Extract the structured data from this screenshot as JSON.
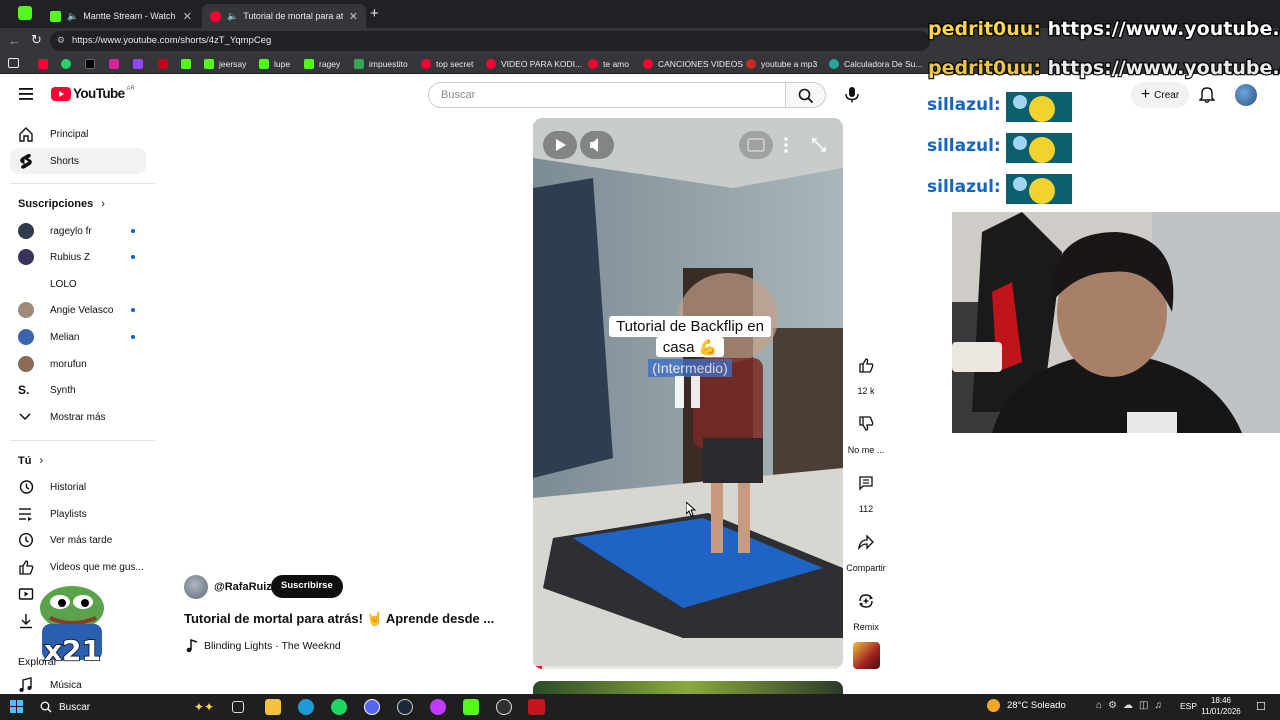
{
  "browser": {
    "tabs": [
      {
        "title": "Mantte Stream - Watch Live o",
        "close": "✕"
      },
      {
        "title": "Tutorial de mortal para atrás! ",
        "close": "✕"
      }
    ],
    "new_tab": "+",
    "url": "https://www.youtube.com/shorts/4zT_YqmpCeg",
    "bookmarks": [
      "jeersay",
      "lupe",
      "ragey",
      "impuestito",
      "top secret",
      "VIDEO PARA KODI...",
      "te amo",
      "CANCIONES VIDEOS",
      "youtube a mp3",
      "Calculadora De Su..."
    ]
  },
  "youtube": {
    "logo_text": "YouTube",
    "country": "AR",
    "search_placeholder": "Buscar",
    "create_label": "Crear",
    "sidebar": {
      "main": [
        {
          "label": "Principal",
          "icon": "home-icon"
        },
        {
          "label": "Shorts",
          "icon": "shorts-icon"
        }
      ],
      "subscriptions_title": "Suscripciones",
      "subscriptions": [
        {
          "label": "rageylo fr",
          "dot": true
        },
        {
          "label": "Rubius Z",
          "dot": true
        },
        {
          "label": "LOLO",
          "dot": false
        },
        {
          "label": "Angie Velasco",
          "dot": true
        },
        {
          "label": "Melian",
          "dot": true
        },
        {
          "label": "morufun",
          "dot": false
        },
        {
          "label": "Synth",
          "dot": false
        }
      ],
      "show_more": "Mostrar más",
      "you_title": "Tú",
      "you_items": [
        {
          "label": "Historial",
          "icon": "history-icon"
        },
        {
          "label": "Playlists",
          "icon": "playlists-icon"
        },
        {
          "label": "Ver más tarde",
          "icon": "watch-later-icon"
        },
        {
          "label": "Videos que me gus...",
          "icon": "liked-icon"
        },
        {
          "label": "",
          "icon": "your-videos-icon"
        },
        {
          "label": "",
          "icon": "downloads-icon"
        }
      ],
      "explore_title": "Explorar",
      "music_label": "Música"
    },
    "short": {
      "channel": "@RafaRuiz",
      "subscribe": "Suscribirse",
      "title": "Tutorial de mortal para atrás! 🤘 Aprende desde ...",
      "music": "Blinding Lights · The Weeknd",
      "caption_line1": "Tutorial de Backflip en",
      "caption_line2": "casa 💪",
      "caption_line3": "(Intermedio)",
      "progress": 0.03
    },
    "actions": [
      {
        "label": "12 k",
        "icon": "like-icon"
      },
      {
        "label": "No me ...",
        "icon": "dislike-icon"
      },
      {
        "label": "112",
        "icon": "comment-icon"
      },
      {
        "label": "Compartir",
        "icon": "share-icon"
      },
      {
        "label": "Remix",
        "icon": "remix-icon"
      }
    ]
  },
  "stream_overlay": {
    "chat_user": "pedrit0uu:",
    "chat_text": "https://www.youtube.com",
    "chat_user2": "pedrit0uu:",
    "chat_text2": "https://www.youtube.com",
    "emote_name": "sillazul:",
    "pepe_text": "x21"
  },
  "taskbar": {
    "search": "Buscar",
    "weather": "28°C  Soleado",
    "lang": "ESP",
    "time": "18:46",
    "date": "11/01/2026"
  }
}
